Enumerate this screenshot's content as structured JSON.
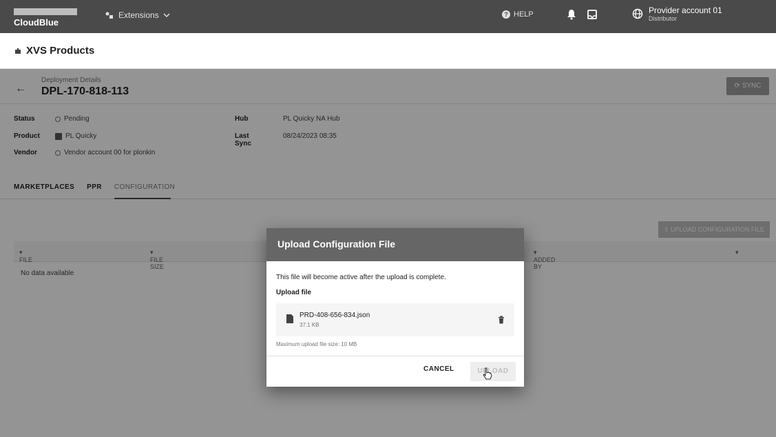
{
  "topbar": {
    "brand": "CloudBlue",
    "module": "Extensions",
    "help": "HELP",
    "account_name": "Provider account 01",
    "account_role": "Distributor"
  },
  "page": {
    "title": "XVS Products"
  },
  "deployment": {
    "subtitle": "Deployment Details",
    "id": "DPL-170-818-113",
    "sync_label": "SYNC"
  },
  "details": {
    "status_label": "Status",
    "status_value": "Pending",
    "product_label": "Product",
    "product_value": "PL Quicky",
    "vendor_label": "Vendor",
    "vendor_value": "Vendor account 00 for plonkin",
    "hub_label": "Hub",
    "hub_value": "PL Quicky NA Hub",
    "lastsync_label": "Last Sync",
    "lastsync_value": "08/24/2023 08:35"
  },
  "tabs": [
    "MARKETPLACES",
    "PPR",
    "CONFIGURATION"
  ],
  "table": {
    "upload_button": "UPLOAD CONFIGURATION FILE",
    "columns": [
      "FILE",
      "FILE SIZE",
      "ADDED BY"
    ],
    "empty": "No data available"
  },
  "modal": {
    "title": "Upload Configuration File",
    "description": "This file will become active after the upload is complete.",
    "upload_label": "Upload file",
    "file_name": "PRD-408-656-834.json",
    "file_size": "37.1 KB",
    "max_size": "Maximum upload file size: 10 MB",
    "cancel": "CANCEL",
    "upload": "UPLOAD"
  }
}
